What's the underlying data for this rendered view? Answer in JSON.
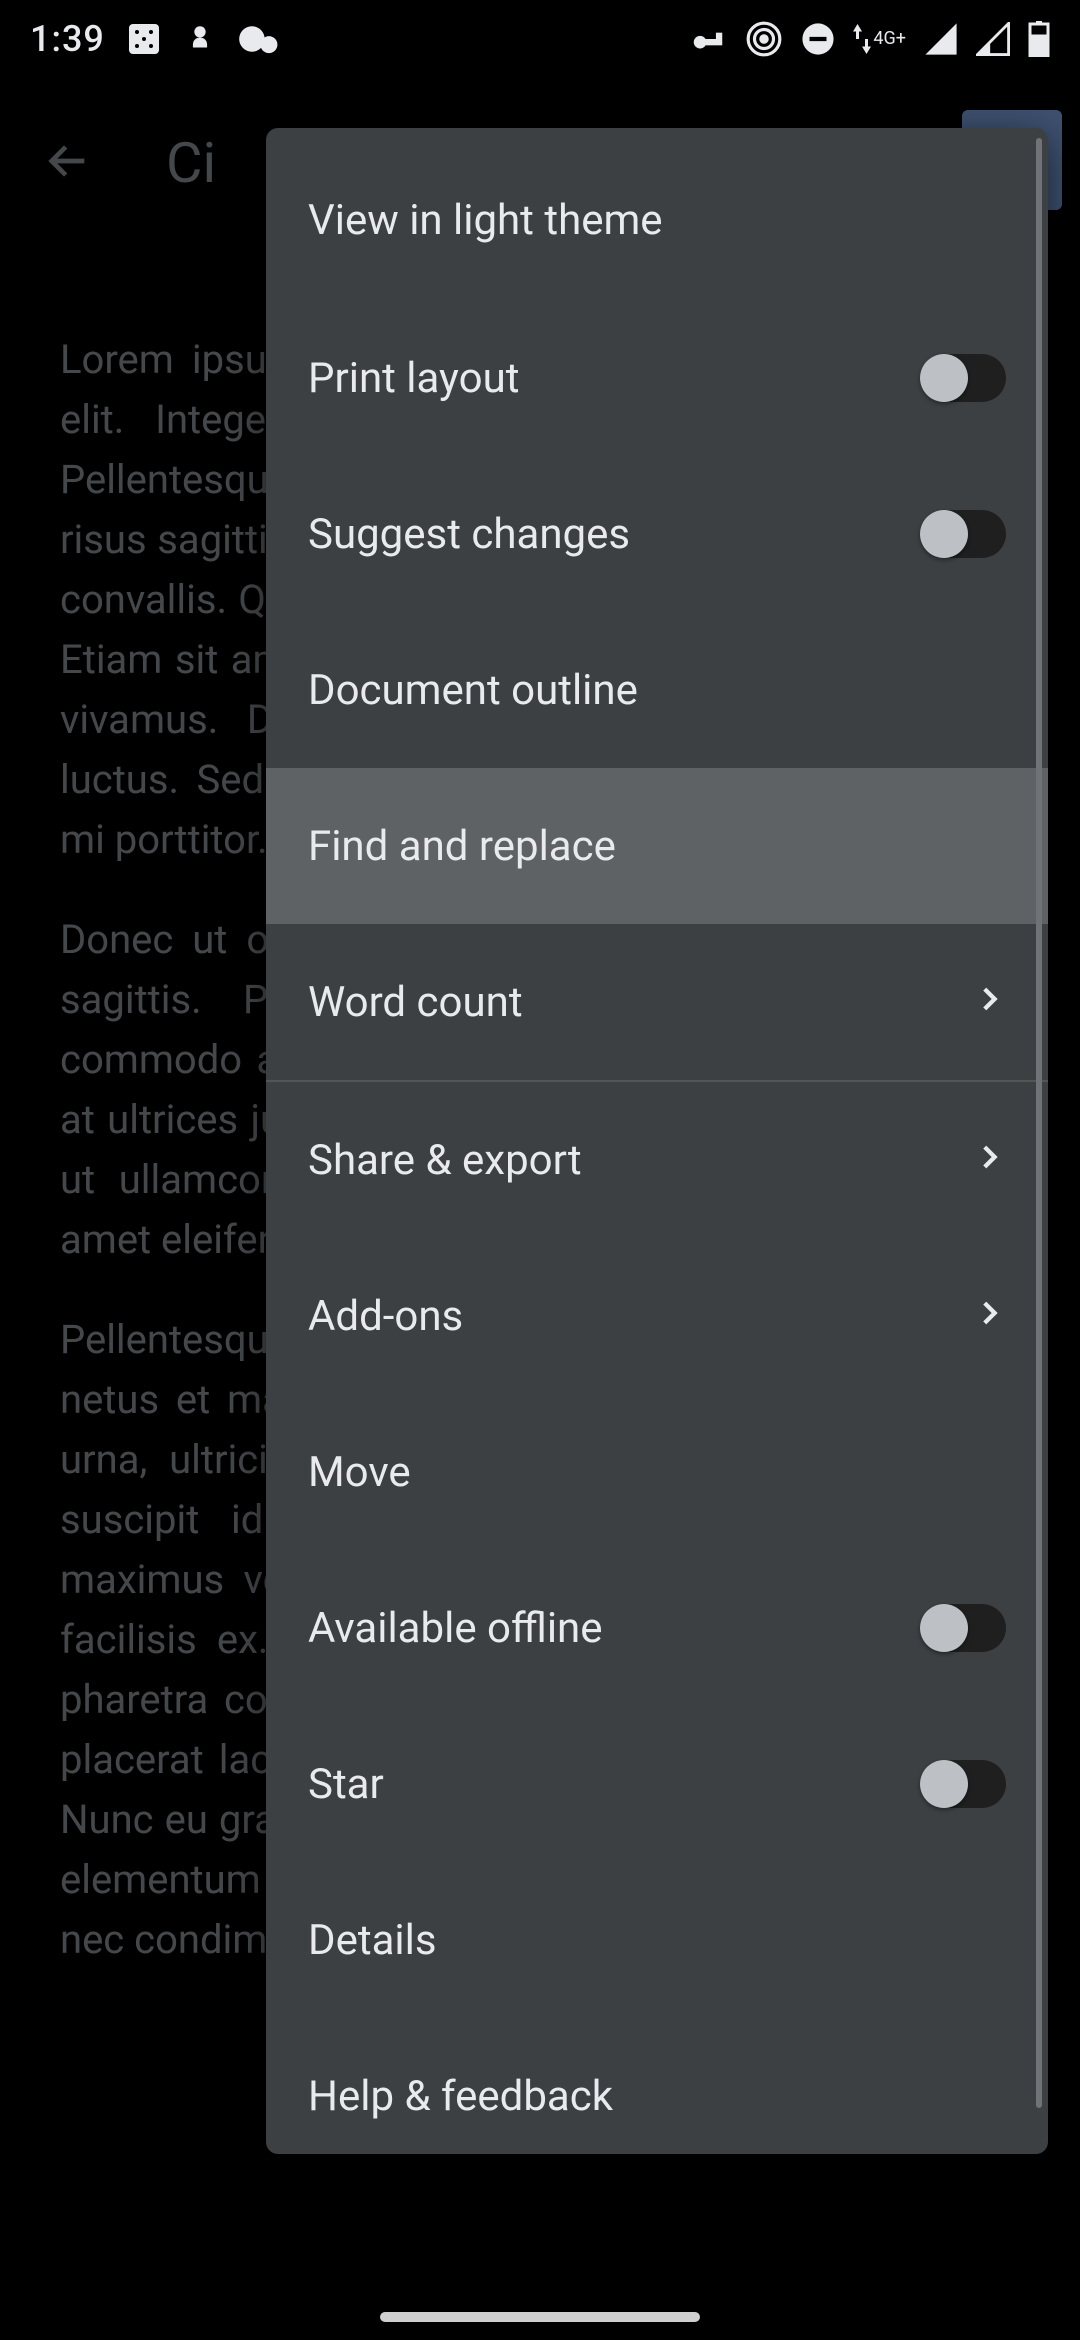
{
  "statusbar": {
    "time": "1:39",
    "network_label": "4G+"
  },
  "topbar": {
    "title_fragment": "Ci"
  },
  "document": {
    "p1": "Lorem ipsum dolor sit amet, consectetur adipiscing elit. Integer feugiat et massa volutpat euismod. Pellentesque laoreet efficitur augue, eget ullamcorper risus sagittis lectus. Integer feugiat mi quis nulla vitae convallis. Quisque dignissim gravida sit amet sagittis. Etiam sit amet neque mollis, luctus sit amet tincidunt vivamus. Duis condimentum eu aliquam erat vel luctus. Sed lobortis massa mi porttitor venenatis at mi porttitor.",
    "p2": "Donec ut odio a justo commodo mattis eget tortor sagittis. Proin aliquet a lacus gravida, lorem commodo accumsan libero auctor risus nibh ultrices at ultrices justo eu felis. Sed id lectus in ligula massa ut ullamcorper vel nisi vitae commodo. Donec sit amet eleifend imperdiet sagittis.",
    "p3": "Pellentesque habitant morbi tristique senectus et netus et malesuada fames ac turpis. Quisque libero urna, ultricies ac dictum nec mauris ultrices ligula suscipit id id orci. Nunc vitae vestibulum felis, maximus vel finibus a. Aliquam non molestie dolor facilisis ex. Morbi sagittis tincidunt imperdiet, vitae pharetra convallis at neque metus id. Sed quis justo placerat lacus, porttitor convallis bibendum id turpis. Nunc eu gravida nisi. Ut blandit tincidunt quam, varius elementum ante sagittis id. Maecenas pretium enim nec condimentum"
  },
  "menu": {
    "view_light": "View in light theme",
    "print_layout": "Print layout",
    "suggest_changes": "Suggest changes",
    "document_outline": "Document outline",
    "find_replace": "Find and replace",
    "word_count": "Word count",
    "share_export": "Share & export",
    "addons": "Add-ons",
    "move": "Move",
    "available_offline": "Available offline",
    "star": "Star",
    "details": "Details",
    "help_feedback": "Help & feedback"
  }
}
